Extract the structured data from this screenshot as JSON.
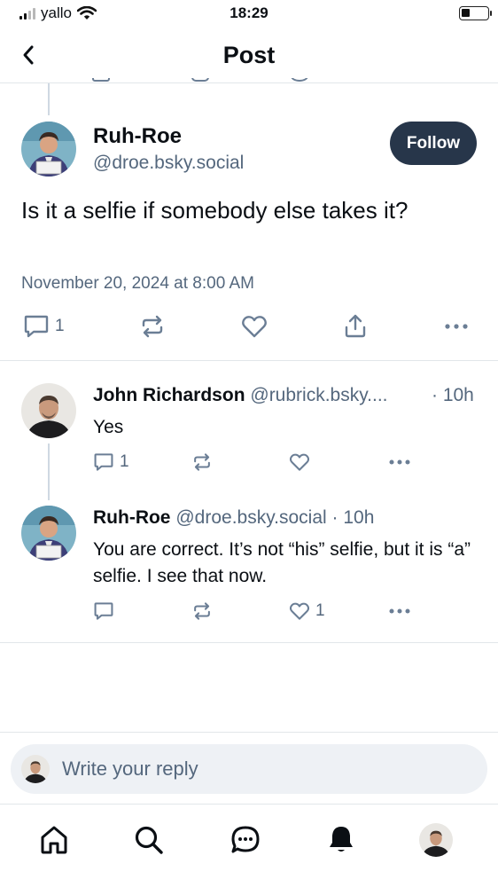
{
  "status_bar": {
    "carrier": "yallo",
    "time": "18:29"
  },
  "header": {
    "title": "Post"
  },
  "main_post": {
    "author_name": "Ruh-Roe",
    "author_handle": "@droe.bsky.social",
    "follow_label": "Follow",
    "text": "Is it a selfie if somebody else takes it?",
    "timestamp": "November 20, 2024 at 8:00 AM",
    "reply_count": "1",
    "icons": [
      "reply-icon",
      "repost-icon",
      "like-icon",
      "share-icon",
      "more-icon"
    ]
  },
  "replies": [
    {
      "author_name": "John Richardson",
      "author_handle": "@rubrick.bsky....",
      "time": "· 10h",
      "text": "Yes",
      "reply_count": "1",
      "like_count": ""
    },
    {
      "author_name": "Ruh-Roe",
      "author_handle": "@droe.bsky.social",
      "time": "· 10h",
      "text": "You are correct. It’s not “his” selfie, but it is “a” selfie. I see that now.",
      "reply_count": "",
      "like_count": "1"
    }
  ],
  "compose": {
    "placeholder": "Write your reply"
  },
  "tabbar": {
    "items": [
      "home-icon",
      "search-icon",
      "chat-icon",
      "notifications-icon",
      "profile-avatar"
    ]
  },
  "colors": {
    "accent_dark": "#27364a",
    "muted_text": "#54677d",
    "icon": "#6b7e95",
    "divider": "#e2e6ea"
  }
}
